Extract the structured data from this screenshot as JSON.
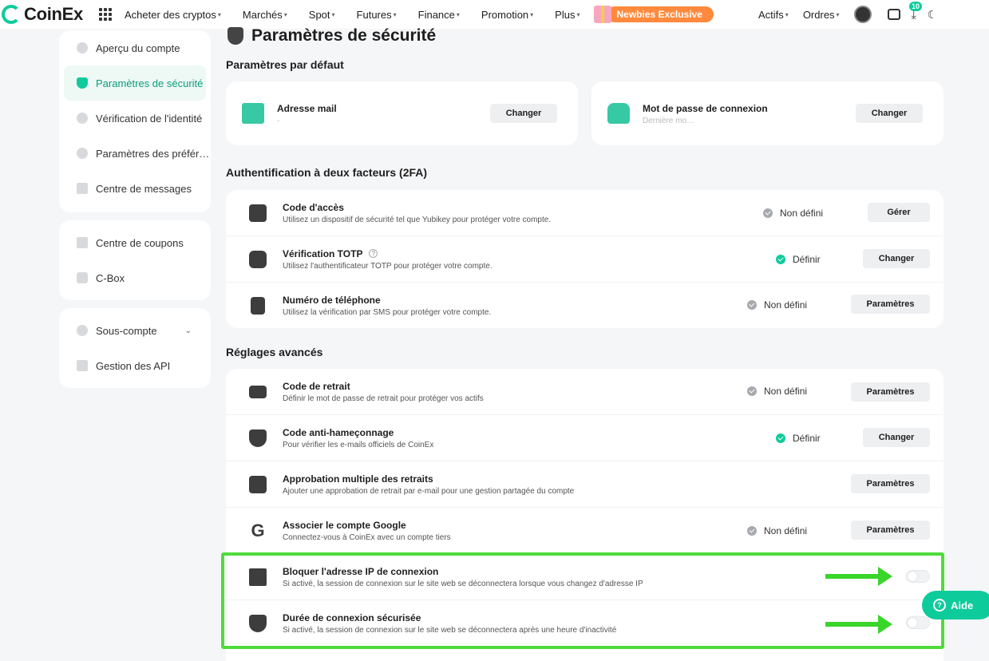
{
  "nav": {
    "brand": "CoinEx",
    "items": [
      {
        "label": "Acheter des cryptos"
      },
      {
        "label": "Marchés"
      },
      {
        "label": "Spot"
      },
      {
        "label": "Futures"
      },
      {
        "label": "Finance"
      },
      {
        "label": "Promotion"
      },
      {
        "label": "Plus"
      }
    ],
    "promo": "Newbies Exclusive",
    "right_items": [
      {
        "label": "Actifs"
      },
      {
        "label": "Ordres"
      }
    ],
    "notif_count": "10",
    "accent": "#0ecb9c"
  },
  "sidebar": {
    "group1": [
      {
        "label": "Aperçu du compte"
      },
      {
        "label": "Paramètres de sécurité"
      },
      {
        "label": "Vérification de l'identité"
      },
      {
        "label": "Paramètres des préfér…"
      },
      {
        "label": "Centre de messages"
      }
    ],
    "group2": [
      {
        "label": "Centre de coupons"
      },
      {
        "label": "C-Box"
      }
    ],
    "group3": [
      {
        "label": "Sous-compte"
      },
      {
        "label": "Gestion des API"
      }
    ]
  },
  "main": {
    "title": "Paramètres de sécurité",
    "defaults": {
      "heading": "Paramètres par défaut",
      "email": {
        "title": "Adresse mail",
        "sub": "-",
        "button": "Changer"
      },
      "password": {
        "title": "Mot de passe de connexion",
        "sub": "Dernière mo…",
        "button": "Changer"
      }
    },
    "twofa": {
      "heading": "Authentification à deux facteurs (2FA)",
      "rows": [
        {
          "title": "Code d'accès",
          "sub": "Utilisez un dispositif de sécurité tel que Yubikey pour protéger votre compte.",
          "status": "Non défini",
          "button": "Gérer"
        },
        {
          "title": "Vérification TOTP",
          "sub": "Utilisez l'authentificateur TOTP pour protéger votre compte.",
          "status": "Définir",
          "button": "Changer"
        },
        {
          "title": "Numéro de téléphone",
          "sub": "Utilisez la vérification par SMS pour protéger votre compte.",
          "status": "Non défini",
          "button": "Paramètres"
        }
      ]
    },
    "advanced": {
      "heading": "Réglages avancés",
      "rows": [
        {
          "title": "Code de retrait",
          "sub": "Définir le mot de passe de retrait pour protéger vos actifs",
          "status": "Non défini",
          "button": "Paramètres"
        },
        {
          "title": "Code anti-hameçonnage",
          "sub": "Pour vérifier les e-mails officiels de CoinEx",
          "status": "Définir",
          "button": "Changer"
        },
        {
          "title": "Approbation multiple des retraits",
          "sub": "Ajouter une approbation de retrait par e-mail pour une gestion partagée du compte",
          "button": "Paramètres"
        },
        {
          "title": "Associer le compte Google",
          "sub": "Connectez-vous à CoinEx avec un compte tiers",
          "status": "Non défini",
          "button": "Paramètres"
        },
        {
          "title": "Bloquer l'adresse IP de connexion",
          "sub": "Si activé, la session de connexion sur le site web se déconnectera lorsque vous changez d'adresse IP",
          "toggle": false
        },
        {
          "title": "Durée de connexion sécurisée",
          "sub": "Si activé, la session de connexion sur le site web se déconnectera après une heure d'inactivité",
          "toggle": false
        }
      ]
    }
  },
  "help": {
    "label": "Aide"
  }
}
